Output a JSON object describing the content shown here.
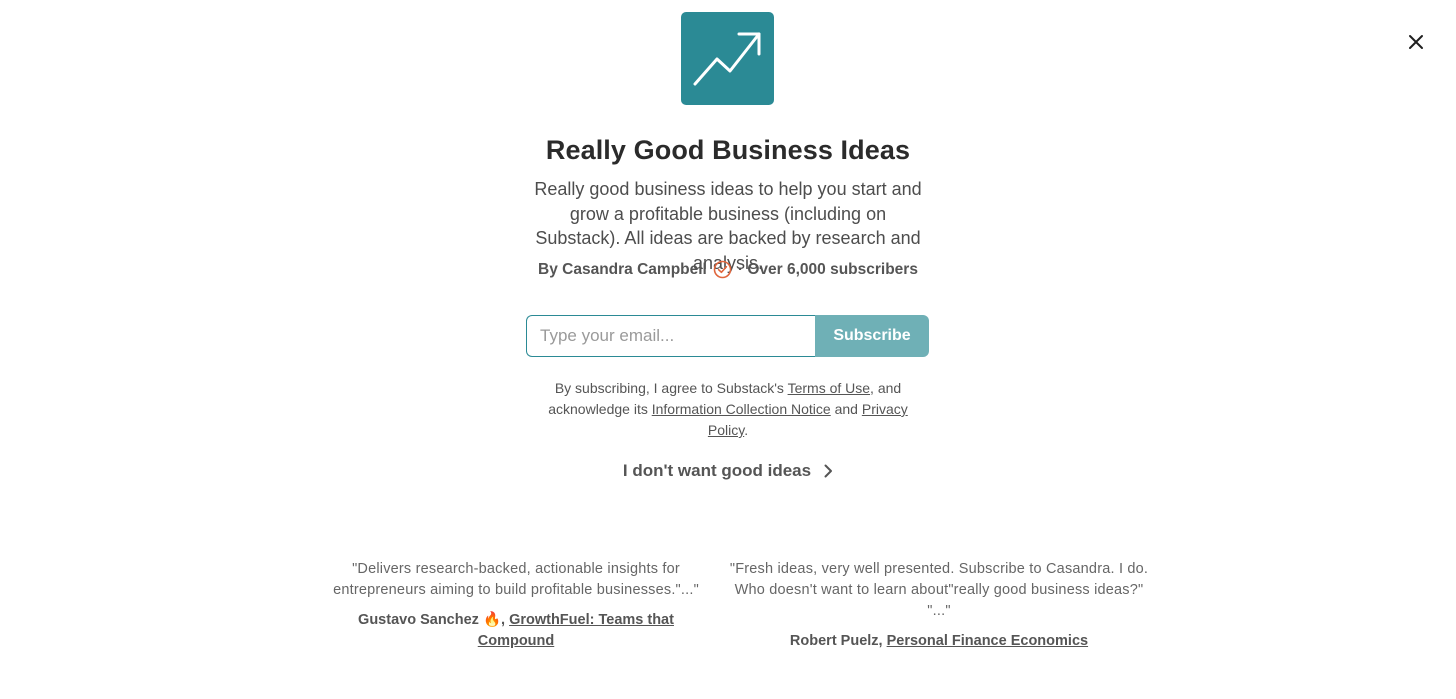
{
  "window": {
    "close_icon": "close-icon"
  },
  "publication": {
    "logo_icon": "trending-up-icon",
    "logo_color": "#2b8a95",
    "title": "Really Good Business Ideas",
    "description": "Really good business ideas to help you start and grow a profitable business (including on Substack). All ideas are backed by research and analysis.",
    "byline_prefix": "By Casandra Campbell",
    "verified_icon": "verified-check-icon",
    "subscriber_text": "· Over 6,000 subscribers"
  },
  "subscribe": {
    "email_placeholder": "Type your email...",
    "button_label": "Subscribe",
    "button_color": "#6fb0b6"
  },
  "legal": {
    "part1": "By subscribing, I agree to Substack's ",
    "terms_link": "Terms of Use",
    "part2": ", and acknowledge its ",
    "info_link": "Information Collection Notice",
    "part3": " and ",
    "privacy_link": "Privacy Policy",
    "part4": "."
  },
  "skip": {
    "label": "I don't want good ideas",
    "icon": "chevron-right-icon"
  },
  "testimonials": [
    {
      "quote": "\"Delivers research-backed, actionable insights for entrepreneurs aiming to build profitable businesses.\"...\"",
      "author": "Gustavo Sanchez 🔥,",
      "link": "GrowthFuel: Teams that Compound"
    },
    {
      "quote": "\"Fresh ideas, very well presented. Subscribe to Casandra. I do. Who doesn't want to learn about\"really good business ideas?\" \"...\"",
      "author": "Robert Puelz,",
      "link": "Personal Finance Economics"
    }
  ]
}
